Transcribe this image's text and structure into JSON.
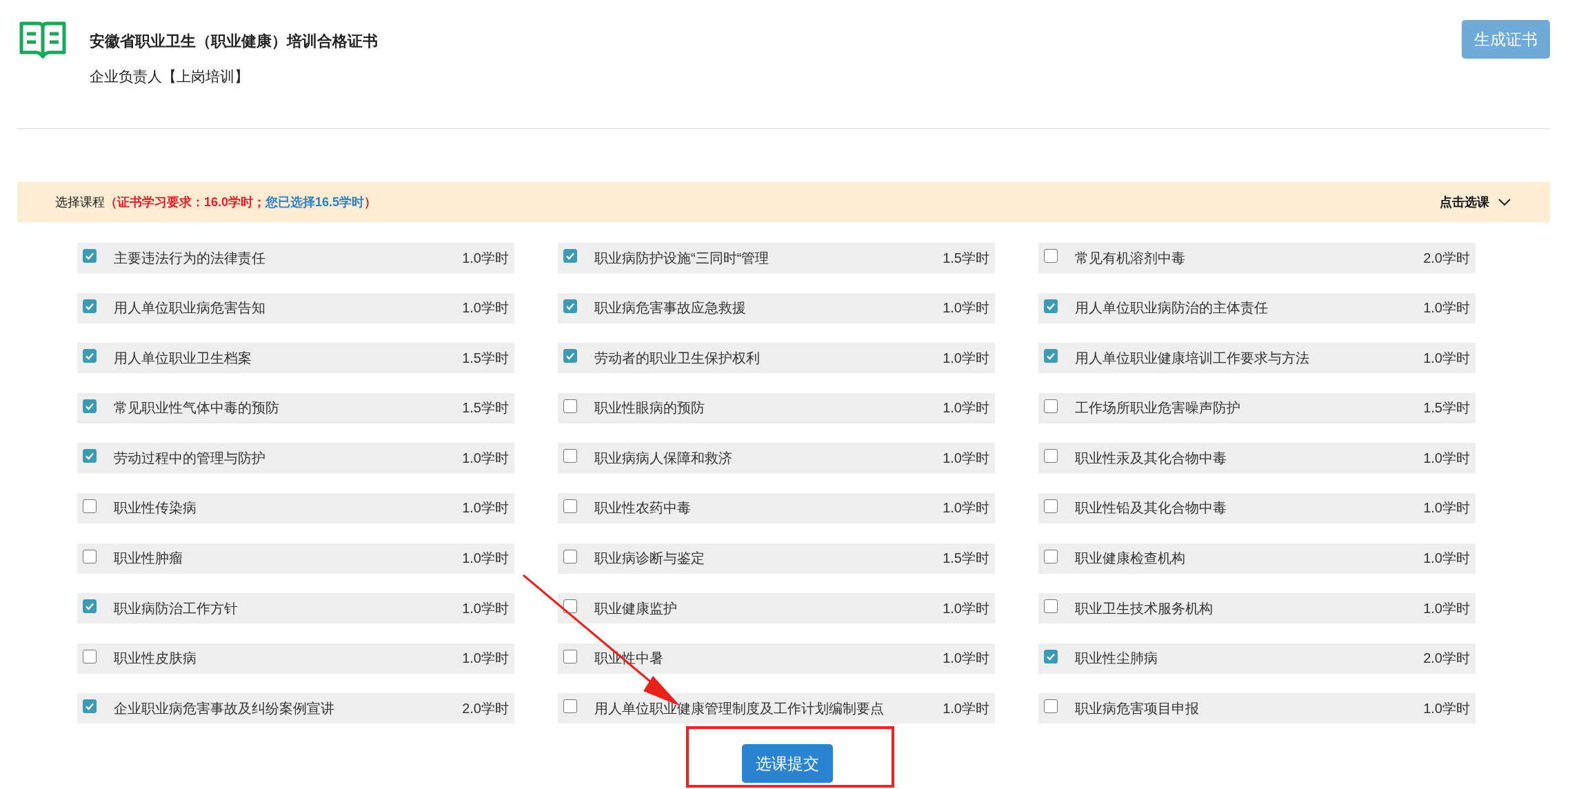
{
  "header": {
    "title": "安徽省职业卫生（职业健康）培训合格证书",
    "subtitle": "企业负责人【上岗培训】",
    "action_button": "生成证书"
  },
  "course_bar": {
    "label": "选择课程",
    "requirement": "（证书学习要求：16.0学时；",
    "selected_total": "您已选择16.5学时",
    "close_paren": "）",
    "toggle": "点击选课"
  },
  "courses": [
    {
      "name": "主要违法行为的法律责任",
      "hours": "1.0学时",
      "checked": true
    },
    {
      "name": "职业病防护设施“三同时“管理",
      "hours": "1.5学时",
      "checked": true
    },
    {
      "name": "常见有机溶剂中毒",
      "hours": "2.0学时",
      "checked": false
    },
    {
      "name": "用人单位职业病危害告知",
      "hours": "1.0学时",
      "checked": true
    },
    {
      "name": "职业病危害事故应急救援",
      "hours": "1.0学时",
      "checked": true
    },
    {
      "name": "用人单位职业病防治的主体责任",
      "hours": "1.0学时",
      "checked": true
    },
    {
      "name": "用人单位职业卫生档案",
      "hours": "1.5学时",
      "checked": true
    },
    {
      "name": "劳动者的职业卫生保护权利",
      "hours": "1.0学时",
      "checked": true
    },
    {
      "name": "用人单位职业健康培训工作要求与方法",
      "hours": "1.0学时",
      "checked": true
    },
    {
      "name": "常见职业性气体中毒的预防",
      "hours": "1.5学时",
      "checked": true
    },
    {
      "name": "职业性眼病的预防",
      "hours": "1.0学时",
      "checked": false
    },
    {
      "name": "工作场所职业危害噪声防护",
      "hours": "1.5学时",
      "checked": false
    },
    {
      "name": "劳动过程中的管理与防护",
      "hours": "1.0学时",
      "checked": true
    },
    {
      "name": "职业病病人保障和救济",
      "hours": "1.0学时",
      "checked": false
    },
    {
      "name": "职业性汞及其化合物中毒",
      "hours": "1.0学时",
      "checked": false
    },
    {
      "name": "职业性传染病",
      "hours": "1.0学时",
      "checked": false
    },
    {
      "name": "职业性农药中毒",
      "hours": "1.0学时",
      "checked": false
    },
    {
      "name": "职业性铅及其化合物中毒",
      "hours": "1.0学时",
      "checked": false
    },
    {
      "name": "职业性肿瘤",
      "hours": "1.0学时",
      "checked": false
    },
    {
      "name": "职业病诊断与鉴定",
      "hours": "1.5学时",
      "checked": false
    },
    {
      "name": "职业健康检查机构",
      "hours": "1.0学时",
      "checked": false
    },
    {
      "name": "职业病防治工作方针",
      "hours": "1.0学时",
      "checked": true
    },
    {
      "name": "职业健康监护",
      "hours": "1.0学时",
      "checked": false
    },
    {
      "name": "职业卫生技术服务机构",
      "hours": "1.0学时",
      "checked": false
    },
    {
      "name": "职业性皮肤病",
      "hours": "1.0学时",
      "checked": false
    },
    {
      "name": "职业性中暑",
      "hours": "1.0学时",
      "checked": false
    },
    {
      "name": "职业性尘肺病",
      "hours": "2.0学时",
      "checked": true
    },
    {
      "name": "企业职业病危害事故及纠纷案例宣讲",
      "hours": "2.0学时",
      "checked": true
    },
    {
      "name": "用人单位职业健康管理制度及工作计划编制要点",
      "hours": "1.0学时",
      "checked": false
    },
    {
      "name": "职业病危害项目申报",
      "hours": "1.0学时",
      "checked": false
    }
  ],
  "submit_button": "选课提交"
}
